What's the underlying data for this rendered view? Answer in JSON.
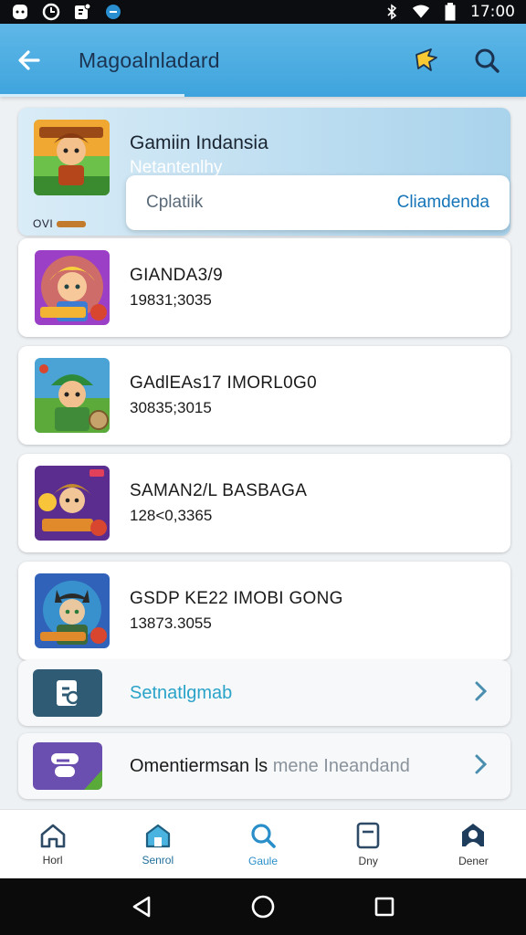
{
  "status_bar": {
    "time": "17:00"
  },
  "app_bar": {
    "title": "Magoalnladard"
  },
  "featured": {
    "name": "Gamiin Indansia",
    "subtitle": "Netantenlhy",
    "tag": "OVI",
    "option_label": "Cplatiik",
    "cta_label": "Cliamdenda"
  },
  "games": [
    {
      "name": "GIANDA3/9",
      "code": "19831;3035",
      "icon": "game-thumbnail-blonde-hero"
    },
    {
      "name": "GAdlEAs17 IMORL0G0",
      "code": "30835;3015",
      "icon": "game-thumbnail-green-warrior"
    },
    {
      "name": "SAMAN2/L BASBAGA",
      "code": "128<0,3365",
      "icon": "game-thumbnail-purple-hero"
    },
    {
      "name": "GSDP KE22 IMOBI GONG",
      "code": "13873.3055",
      "icon": "game-thumbnail-cat-ninja"
    }
  ],
  "rows": [
    {
      "label": "Setnatlgmab",
      "icon": "document-icon",
      "color": "#2aa3c9"
    },
    {
      "label_primary": "Omentiermsan ls",
      "label_secondary": "mene Ineandand",
      "icon": "chat-icon"
    }
  ],
  "bottom_nav": [
    {
      "label": "Horl",
      "icon": "home-icon"
    },
    {
      "label": "Senrol",
      "icon": "store-icon"
    },
    {
      "label": "Gaule",
      "icon": "search-icon"
    },
    {
      "label": "Dny",
      "icon": "tablet-icon"
    },
    {
      "label": "Dener",
      "icon": "profile-icon"
    }
  ],
  "colors": {
    "app_bar": "#3ea4dd",
    "accent": "#2aa3c9",
    "title": "#1b3350"
  }
}
